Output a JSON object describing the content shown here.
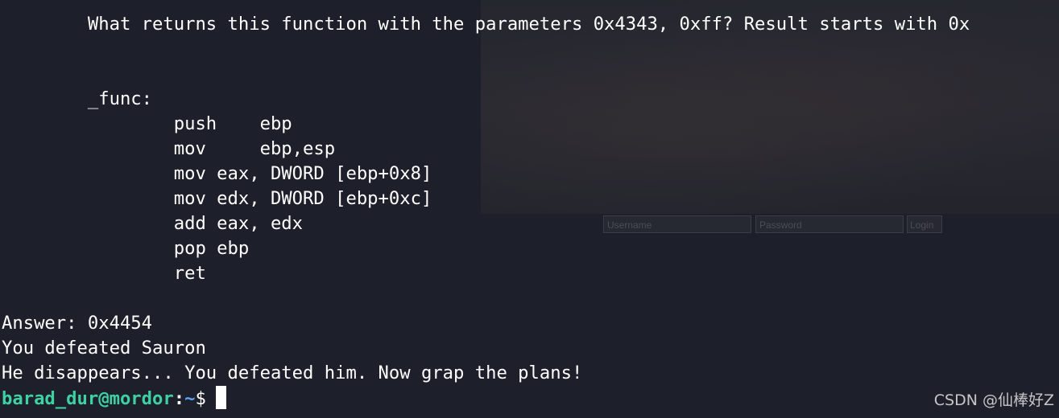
{
  "background_form": {
    "username_placeholder": "Username",
    "password_placeholder": "Password",
    "login_label": "Login"
  },
  "terminal": {
    "lines": [
      "        What returns this function with the parameters 0x4343, 0xff? Result starts with 0x",
      "",
      "",
      "        _func:",
      "                push    ebp",
      "                mov     ebp,esp",
      "                mov eax, DWORD [ebp+0x8]",
      "                mov edx, DWORD [ebp+0xc]",
      "                add eax, edx",
      "                pop ebp",
      "                ret",
      "",
      "Answer: 0x4454",
      "You defeated Sauron",
      "He disappears... You defeated him. Now grap the plans!"
    ],
    "prompt": {
      "user_host": "barad_dur@mordor",
      "separator": ":",
      "path": "~",
      "symbol": "$"
    }
  },
  "watermark": "CSDN @仙棒好Z"
}
